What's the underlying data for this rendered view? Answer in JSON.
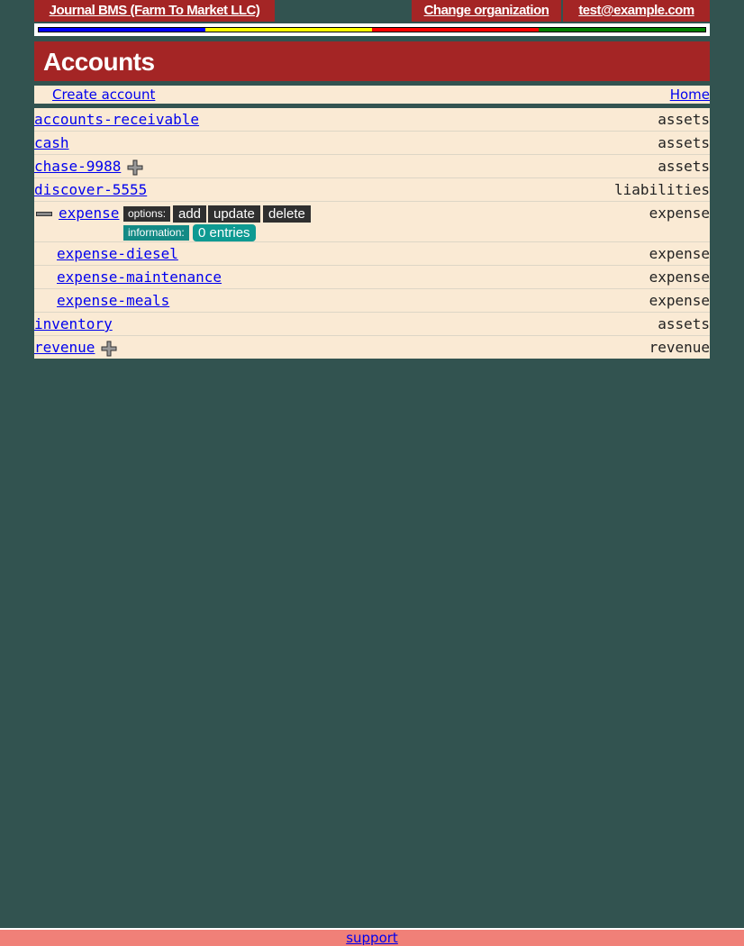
{
  "topbar": {
    "app_title": "Journal BMS (Farm To Market LLC)",
    "change_org": "Change organization",
    "user_email": "test@example.com"
  },
  "stripe_colors": [
    "#0000ff",
    "#ffff00",
    "#ff0000",
    "#008000"
  ],
  "page_title": "Accounts",
  "actions": {
    "create": "Create account",
    "home": "Home"
  },
  "accounts": [
    {
      "name": "accounts-receivable",
      "type": "assets"
    },
    {
      "name": "cash",
      "type": "assets"
    },
    {
      "name": "chase-9988",
      "type": "assets"
    },
    {
      "name": "discover-5555",
      "type": "liabilities"
    },
    {
      "name": "expense",
      "type": "expense"
    },
    {
      "name": "expense-diesel",
      "type": "expense"
    },
    {
      "name": "expense-maintenance",
      "type": "expense"
    },
    {
      "name": "expense-meals",
      "type": "expense"
    },
    {
      "name": "inventory",
      "type": "assets"
    },
    {
      "name": "revenue",
      "type": "revenue"
    }
  ],
  "expense_panel": {
    "options_label": "options:",
    "add": "add",
    "update": "update",
    "delete": "delete",
    "information_label": "information:",
    "entries": "0 entries"
  },
  "footer": {
    "support": "support"
  }
}
